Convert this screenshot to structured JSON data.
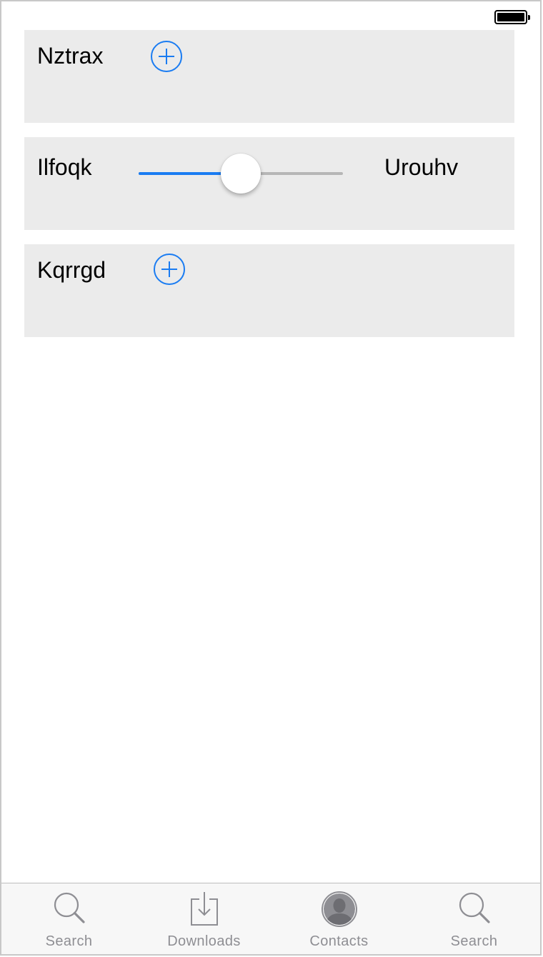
{
  "status_bar": {
    "battery_level": 1.0
  },
  "rows": [
    {
      "label": "Nztrax",
      "control": "add-button",
      "icon": "plus-circle-icon"
    },
    {
      "label": "Ilfoqk",
      "control": "slider",
      "slider_value": 0.5,
      "value_label": "Urouhv"
    },
    {
      "label": "Kqrrgd",
      "control": "add-button",
      "icon": "plus-circle-icon"
    }
  ],
  "tab_bar": {
    "tabs": [
      {
        "label": "Search",
        "icon": "search-icon"
      },
      {
        "label": "Downloads",
        "icon": "download-icon"
      },
      {
        "label": "Contacts",
        "icon": "contacts-icon"
      },
      {
        "label": "Search",
        "icon": "search-icon"
      }
    ]
  },
  "colors": {
    "accent": "#1a7cf2",
    "card_background": "#ebebeb",
    "tab_inactive": "#8e8e93",
    "slider_track": "#b6b6b6"
  }
}
